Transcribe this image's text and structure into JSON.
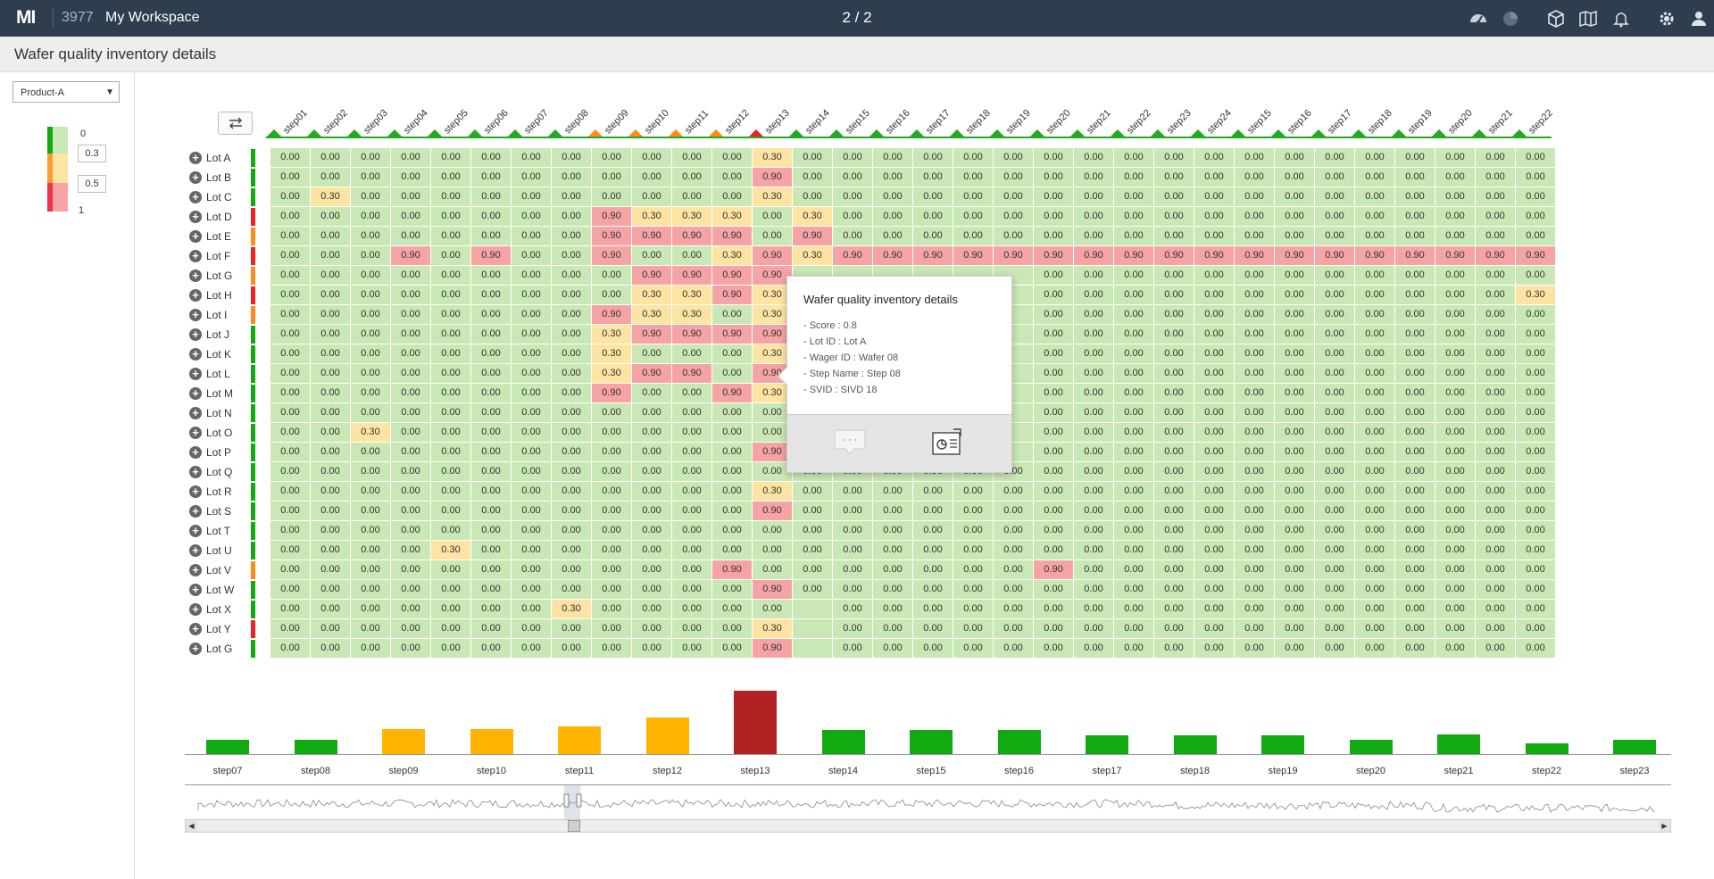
{
  "app": {
    "logo": "MI",
    "workspace_id": "3977",
    "workspace_name": "My Workspace",
    "page_indicator": "2 / 2"
  },
  "toolbar_icons": [
    "dashboard-icon",
    "pie-chart-icon",
    "cube-icon",
    "map-icon",
    "bell-icon",
    "settings-icon",
    "user-icon"
  ],
  "page": {
    "title": "Wafer quality inventory details"
  },
  "filter": {
    "product": "Product-A"
  },
  "legend": {
    "min": "0",
    "threshold_low": "0.3",
    "threshold_high": "0.5",
    "max": "1"
  },
  "colors": {
    "good": "#c9e8b5",
    "warn": "#fde4a3",
    "bad": "#f6a3a6",
    "green": "#11aa11",
    "orange": "#ffb400",
    "red": "#b22222"
  },
  "heatmap": {
    "columns": [
      "step01",
      "step02",
      "step03",
      "step04",
      "step05",
      "step06",
      "step07",
      "step08",
      "step09",
      "step10",
      "step11",
      "step12",
      "step13",
      "step14",
      "step15",
      "step16",
      "step17",
      "step18",
      "step19",
      "step20",
      "step21",
      "step22",
      "step23",
      "step24",
      "step15",
      "step16",
      "step17",
      "step18",
      "step19",
      "step20",
      "step21",
      "step22"
    ],
    "column_status": [
      "g",
      "g",
      "g",
      "g",
      "g",
      "g",
      "g",
      "g",
      "o",
      "o",
      "o",
      "o",
      "r",
      "g",
      "g",
      "g",
      "g",
      "g",
      "g",
      "g",
      "g",
      "g",
      "g",
      "g",
      "g",
      "g",
      "g",
      "g",
      "g",
      "g",
      "g",
      "g"
    ],
    "rows": [
      {
        "label": "Lot A",
        "status": "g",
        "values": [
          "0.00",
          "0.00",
          "0.00",
          "0.00",
          "0.00",
          "0.00",
          "0.00",
          "0.00",
          "0.00",
          "0.00",
          "0.00",
          "0.00",
          "0.30",
          "0.00",
          "0.00",
          "0.00",
          "0.00",
          "0.00",
          "0.00",
          "0.00",
          "0.00",
          "0.00",
          "0.00",
          "0.00",
          "0.00",
          "0.00",
          "0.00",
          "0.00",
          "0.00",
          "0.00",
          "0.00",
          "0.00"
        ]
      },
      {
        "label": "Lot B",
        "status": "g",
        "values": [
          "0.00",
          "0.00",
          "0.00",
          "0.00",
          "0.00",
          "0.00",
          "0.00",
          "0.00",
          "0.00",
          "0.00",
          "0.00",
          "0.00",
          "0.90",
          "0.00",
          "0.00",
          "0.00",
          "0.00",
          "0.00",
          "0.00",
          "0.00",
          "0.00",
          "0.00",
          "0.00",
          "0.00",
          "0.00",
          "0.00",
          "0.00",
          "0.00",
          "0.00",
          "0.00",
          "0.00",
          "0.00"
        ]
      },
      {
        "label": "Lot C",
        "status": "g",
        "values": [
          "0.00",
          "0.30",
          "0.00",
          "0.00",
          "0.00",
          "0.00",
          "0.00",
          "0.00",
          "0.00",
          "0.00",
          "0.00",
          "0.00",
          "0.30",
          "0.00",
          "0.00",
          "0.00",
          "0.00",
          "0.00",
          "0.00",
          "0.00",
          "0.00",
          "0.00",
          "0.00",
          "0.00",
          "0.00",
          "0.00",
          "0.00",
          "0.00",
          "0.00",
          "0.00",
          "0.00",
          "0.00"
        ]
      },
      {
        "label": "Lot D",
        "status": "r",
        "values": [
          "0.00",
          "0.00",
          "0.00",
          "0.00",
          "0.00",
          "0.00",
          "0.00",
          "0.00",
          "0.90",
          "0.30",
          "0.30",
          "0.30",
          "0.00",
          "0.30",
          "0.00",
          "0.00",
          "0.00",
          "0.00",
          "0.00",
          "0.00",
          "0.00",
          "0.00",
          "0.00",
          "0.00",
          "0.00",
          "0.00",
          "0.00",
          "0.00",
          "0.00",
          "0.00",
          "0.00",
          "0.00"
        ]
      },
      {
        "label": "Lot E",
        "status": "o",
        "values": [
          "0.00",
          "0.00",
          "0.00",
          "0.00",
          "0.00",
          "0.00",
          "0.00",
          "0.00",
          "0.90",
          "0.90",
          "0.90",
          "0.90",
          "0.00",
          "0.90",
          "0.00",
          "0.00",
          "0.00",
          "0.00",
          "0.00",
          "0.00",
          "0.00",
          "0.00",
          "0.00",
          "0.00",
          "0.00",
          "0.00",
          "0.00",
          "0.00",
          "0.00",
          "0.00",
          "0.00",
          "0.00"
        ]
      },
      {
        "label": "Lot F",
        "status": "r",
        "values": [
          "0.00",
          "0.00",
          "0.00",
          "0.90",
          "0.00",
          "0.90",
          "0.00",
          "0.00",
          "0.90",
          "0.00",
          "0.00",
          "0.30",
          "0.90",
          "0.30",
          "0.90",
          "0.90",
          "0.90",
          "0.90",
          "0.90",
          "0.90",
          "0.90",
          "0.90",
          "0.90",
          "0.90",
          "0.90",
          "0.90",
          "0.90",
          "0.90",
          "0.90",
          "0.90",
          "0.90",
          "0.90"
        ]
      },
      {
        "label": "Lot G",
        "status": "o",
        "values": [
          "0.00",
          "0.00",
          "0.00",
          "0.00",
          "0.00",
          "0.00",
          "0.00",
          "0.00",
          "0.00",
          "0.90",
          "0.90",
          "0.90",
          "0.90",
          "",
          "",
          "",
          "",
          "",
          "",
          "0.00",
          "0.00",
          "0.00",
          "0.00",
          "0.00",
          "0.00",
          "0.00",
          "0.00",
          "0.00",
          "0.00",
          "0.00",
          "0.00",
          "0.00"
        ]
      },
      {
        "label": "Lot H",
        "status": "r",
        "values": [
          "0.00",
          "0.00",
          "0.00",
          "0.00",
          "0.00",
          "0.00",
          "0.00",
          "0.00",
          "0.00",
          "0.30",
          "0.30",
          "0.90",
          "0.30",
          "",
          "",
          "",
          "",
          "",
          "",
          "0.00",
          "0.00",
          "0.00",
          "0.00",
          "0.00",
          "0.00",
          "0.00",
          "0.00",
          "0.00",
          "0.00",
          "0.00",
          "0.00",
          "0.30"
        ]
      },
      {
        "label": "Lot I",
        "status": "o",
        "values": [
          "0.00",
          "0.00",
          "0.00",
          "0.00",
          "0.00",
          "0.00",
          "0.00",
          "0.00",
          "0.90",
          "0.30",
          "0.30",
          "0.00",
          "0.30",
          "",
          "",
          "",
          "",
          "",
          "",
          "0.00",
          "0.00",
          "0.00",
          "0.00",
          "0.00",
          "0.00",
          "0.00",
          "0.00",
          "0.00",
          "0.00",
          "0.00",
          "0.00",
          "0.00"
        ]
      },
      {
        "label": "Lot J",
        "status": "g",
        "values": [
          "0.00",
          "0.00",
          "0.00",
          "0.00",
          "0.00",
          "0.00",
          "0.00",
          "0.00",
          "0.30",
          "0.90",
          "0.90",
          "0.90",
          "0.90",
          "",
          "",
          "",
          "",
          "",
          "",
          "0.00",
          "0.00",
          "0.00",
          "0.00",
          "0.00",
          "0.00",
          "0.00",
          "0.00",
          "0.00",
          "0.00",
          "0.00",
          "0.00",
          "0.00"
        ]
      },
      {
        "label": "Lot K",
        "status": "g",
        "values": [
          "0.00",
          "0.00",
          "0.00",
          "0.00",
          "0.00",
          "0.00",
          "0.00",
          "0.00",
          "0.30",
          "0.00",
          "0.00",
          "0.00",
          "0.30",
          "",
          "",
          "",
          "",
          "",
          "",
          "0.00",
          "0.00",
          "0.00",
          "0.00",
          "0.00",
          "0.00",
          "0.00",
          "0.00",
          "0.00",
          "0.00",
          "0.00",
          "0.00",
          "0.00"
        ]
      },
      {
        "label": "Lot L",
        "status": "g",
        "values": [
          "0.00",
          "0.00",
          "0.00",
          "0.00",
          "0.00",
          "0.00",
          "0.00",
          "0.00",
          "0.30",
          "0.90",
          "0.90",
          "0.00",
          "0.90",
          "",
          "",
          "",
          "",
          "",
          "",
          "0.00",
          "0.00",
          "0.00",
          "0.00",
          "0.00",
          "0.00",
          "0.00",
          "0.00",
          "0.00",
          "0.00",
          "0.00",
          "0.00",
          "0.00"
        ]
      },
      {
        "label": "Lot M",
        "status": "g",
        "values": [
          "0.00",
          "0.00",
          "0.00",
          "0.00",
          "0.00",
          "0.00",
          "0.00",
          "0.00",
          "0.90",
          "0.00",
          "0.00",
          "0.90",
          "0.30",
          "",
          "",
          "",
          "",
          "",
          "",
          "0.00",
          "0.00",
          "0.00",
          "0.00",
          "0.00",
          "0.00",
          "0.00",
          "0.00",
          "0.00",
          "0.00",
          "0.00",
          "0.00",
          "0.00"
        ]
      },
      {
        "label": "Lot N",
        "status": "g",
        "values": [
          "0.00",
          "0.00",
          "0.00",
          "0.00",
          "0.00",
          "0.00",
          "0.00",
          "0.00",
          "0.00",
          "0.00",
          "0.00",
          "0.00",
          "0.00",
          "",
          "",
          "",
          "",
          "",
          "",
          "0.00",
          "0.00",
          "0.00",
          "0.00",
          "0.00",
          "0.00",
          "0.00",
          "0.00",
          "0.00",
          "0.00",
          "0.00",
          "0.00",
          "0.00"
        ]
      },
      {
        "label": "Lot O",
        "status": "g",
        "values": [
          "0.00",
          "0.00",
          "0.30",
          "0.00",
          "0.00",
          "0.00",
          "0.00",
          "0.00",
          "0.00",
          "0.00",
          "0.00",
          "0.00",
          "0.00",
          "",
          "",
          "",
          "",
          "",
          "",
          "0.00",
          "0.00",
          "0.00",
          "0.00",
          "0.00",
          "0.00",
          "0.00",
          "0.00",
          "0.00",
          "0.00",
          "0.00",
          "0.00",
          "0.00"
        ]
      },
      {
        "label": "Lot P",
        "status": "g",
        "values": [
          "0.00",
          "0.00",
          "0.00",
          "0.00",
          "0.00",
          "0.00",
          "0.00",
          "0.00",
          "0.00",
          "0.00",
          "0.00",
          "0.00",
          "0.90",
          "",
          "",
          "",
          "",
          "",
          "",
          "0.00",
          "0.00",
          "0.00",
          "0.00",
          "0.00",
          "0.00",
          "0.00",
          "0.00",
          "0.00",
          "0.00",
          "0.00",
          "0.00",
          "0.00"
        ]
      },
      {
        "label": "Lot Q",
        "status": "g",
        "values": [
          "0.00",
          "0.00",
          "0.00",
          "0.00",
          "0.00",
          "0.00",
          "0.00",
          "0.00",
          "0.00",
          "0.00",
          "0.00",
          "0.00",
          "0.00",
          "0.00",
          "0.00",
          "0.00",
          "0.00",
          "0.00",
          "0.00",
          "0.00",
          "0.00",
          "0.00",
          "0.00",
          "0.00",
          "0.00",
          "0.00",
          "0.00",
          "0.00",
          "0.00",
          "0.00",
          "0.00",
          "0.00"
        ]
      },
      {
        "label": "Lot R",
        "status": "g",
        "values": [
          "0.00",
          "0.00",
          "0.00",
          "0.00",
          "0.00",
          "0.00",
          "0.00",
          "0.00",
          "0.00",
          "0.00",
          "0.00",
          "0.00",
          "0.30",
          "0.00",
          "0.00",
          "0.00",
          "0.00",
          "0.00",
          "0.00",
          "0.00",
          "0.00",
          "0.00",
          "0.00",
          "0.00",
          "0.00",
          "0.00",
          "0.00",
          "0.00",
          "0.00",
          "0.00",
          "0.00",
          "0.00"
        ]
      },
      {
        "label": "Lot S",
        "status": "g",
        "values": [
          "0.00",
          "0.00",
          "0.00",
          "0.00",
          "0.00",
          "0.00",
          "0.00",
          "0.00",
          "0.00",
          "0.00",
          "0.00",
          "0.00",
          "0.90",
          "0.00",
          "0.00",
          "0.00",
          "0.00",
          "0.00",
          "0.00",
          "0.00",
          "0.00",
          "0.00",
          "0.00",
          "0.00",
          "0.00",
          "0.00",
          "0.00",
          "0.00",
          "0.00",
          "0.00",
          "0.00",
          "0.00"
        ]
      },
      {
        "label": "Lot T",
        "status": "g",
        "values": [
          "0.00",
          "0.00",
          "0.00",
          "0.00",
          "0.00",
          "0.00",
          "0.00",
          "0.00",
          "0.00",
          "0.00",
          "0.00",
          "0.00",
          "0.00",
          "0.00",
          "0.00",
          "0.00",
          "0.00",
          "0.00",
          "0.00",
          "0.00",
          "0.00",
          "0.00",
          "0.00",
          "0.00",
          "0.00",
          "0.00",
          "0.00",
          "0.00",
          "0.00",
          "0.00",
          "0.00",
          "0.00"
        ]
      },
      {
        "label": "Lot U",
        "status": "g",
        "values": [
          "0.00",
          "0.00",
          "0.00",
          "0.00",
          "0.30",
          "0.00",
          "0.00",
          "0.00",
          "0.00",
          "0.00",
          "0.00",
          "0.00",
          "0.00",
          "0.00",
          "0.00",
          "0.00",
          "0.00",
          "0.00",
          "0.00",
          "0.00",
          "0.00",
          "0.00",
          "0.00",
          "0.00",
          "0.00",
          "0.00",
          "0.00",
          "0.00",
          "0.00",
          "0.00",
          "0.00",
          "0.00"
        ]
      },
      {
        "label": "Lot V",
        "status": "o",
        "values": [
          "0.00",
          "0.00",
          "0.00",
          "0.00",
          "0.00",
          "0.00",
          "0.00",
          "0.00",
          "0.00",
          "0.00",
          "0.00",
          "0.90",
          "0.00",
          "0.00",
          "0.00",
          "0.00",
          "0.00",
          "0.00",
          "0.00",
          "0.90",
          "0.00",
          "0.00",
          "0.00",
          "0.00",
          "0.00",
          "0.00",
          "0.00",
          "0.00",
          "0.00",
          "0.00",
          "0.00",
          "0.00"
        ]
      },
      {
        "label": "Lot W",
        "status": "g",
        "values": [
          "0.00",
          "0.00",
          "0.00",
          "0.00",
          "0.00",
          "0.00",
          "0.00",
          "0.00",
          "0.00",
          "0.00",
          "0.00",
          "0.00",
          "0.90",
          "0.00",
          "0.00",
          "0.00",
          "0.00",
          "0.00",
          "0.00",
          "0.00",
          "0.00",
          "0.00",
          "0.00",
          "0.00",
          "0.00",
          "0.00",
          "0.00",
          "0.00",
          "0.00",
          "0.00",
          "0.00",
          "0.00"
        ]
      },
      {
        "label": "Lot X",
        "status": "g",
        "values": [
          "0.00",
          "0.00",
          "0.00",
          "0.00",
          "0.00",
          "0.00",
          "0.00",
          "0.30",
          "0.00",
          "0.00",
          "0.00",
          "0.00",
          "0.00",
          "",
          "0.00",
          "0.00",
          "0.00",
          "0.00",
          "0.00",
          "0.00",
          "0.00",
          "0.00",
          "0.00",
          "0.00",
          "0.00",
          "0.00",
          "0.00",
          "0.00",
          "0.00",
          "0.00",
          "0.00",
          "0.00"
        ]
      },
      {
        "label": "Lot Y",
        "status": "r",
        "values": [
          "0.00",
          "0.00",
          "0.00",
          "0.00",
          "0.00",
          "0.00",
          "0.00",
          "0.00",
          "0.00",
          "0.00",
          "0.00",
          "0.00",
          "0.30",
          "",
          "0.00",
          "0.00",
          "0.00",
          "0.00",
          "0.00",
          "0.00",
          "0.00",
          "0.00",
          "0.00",
          "0.00",
          "0.00",
          "0.00",
          "0.00",
          "0.00",
          "0.00",
          "0.00",
          "0.00",
          "0.00"
        ]
      },
      {
        "label": "Lot G",
        "status": "g",
        "values": [
          "0.00",
          "0.00",
          "0.00",
          "0.00",
          "0.00",
          "0.00",
          "0.00",
          "0.00",
          "0.00",
          "0.00",
          "0.00",
          "0.00",
          "0.90",
          "",
          "0.00",
          "0.00",
          "0.00",
          "0.00",
          "0.00",
          "0.00",
          "0.00",
          "0.00",
          "0.00",
          "0.00",
          "0.00",
          "0.00",
          "0.00",
          "0.00",
          "0.00",
          "0.00",
          "0.00",
          "0.00"
        ]
      }
    ]
  },
  "tooltip": {
    "title": "Wafer quality inventory details",
    "lines": [
      "- Score : 0.8",
      "- Lot ID : Lot A",
      "- Wager ID : Wafer 08",
      "- Step Name : Step 08",
      "- SVID : SIVD 18"
    ]
  },
  "chart_data": {
    "type": "bar",
    "categories": [
      "step07",
      "step08",
      "step09",
      "step10",
      "step11",
      "step12",
      "step13",
      "step14",
      "step15",
      "step16",
      "step17",
      "step18",
      "step19",
      "step20",
      "step21",
      "step22",
      "step23"
    ],
    "values": [
      17,
      17,
      29,
      29,
      32,
      42,
      72,
      28,
      28,
      28,
      22,
      22,
      22,
      17,
      23,
      13,
      17
    ],
    "status": [
      "green",
      "green",
      "orange",
      "orange",
      "orange",
      "orange",
      "red",
      "green",
      "green",
      "green",
      "green",
      "green",
      "green",
      "green",
      "green",
      "green",
      "green"
    ],
    "title": "",
    "xlabel": "",
    "ylabel": "",
    "ylim": [
      0,
      80
    ],
    "grid": false,
    "legend": "none"
  }
}
